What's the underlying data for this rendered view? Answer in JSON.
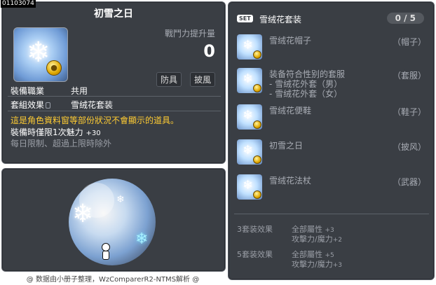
{
  "id_tag": "01103074",
  "item": {
    "name": "初雪之日",
    "power_label": "戰鬥力提升量",
    "power_value": "0",
    "tags": [
      "防具",
      "披風"
    ],
    "job_label": "裝備職業",
    "job_value": "共用",
    "set_label": "套組效果",
    "set_value": "雪绒花套装",
    "warning": "這是角色資料窗等部份狀況不會顯示的道具。",
    "charm_text": "裝備時僅限1次魅力",
    "charm_value": "+30",
    "daily_limit": "每日限制、超過上限時除外"
  },
  "footer": "@ 数据由小册子整理，WzComparerR2-NTMS解析 @",
  "set": {
    "badge": "SET",
    "name": "雪绒花套装",
    "count": "0 / 5",
    "items": [
      {
        "label": "雪绒花帽子",
        "type": "（帽子）"
      },
      {
        "label": "装备符合性别的套服",
        "type": "（套服）",
        "subs": [
          "- 雪绒花外套（男）",
          "- 雪绒花外套（女）"
        ]
      },
      {
        "label": "雪绒花便鞋",
        "type": "（鞋子）"
      },
      {
        "label": "初雪之日",
        "type": "（披风）"
      },
      {
        "label": "雪绒花法杖",
        "type": "（武器）"
      }
    ],
    "bonuses": [
      {
        "label": "3套装效果",
        "lines": [
          {
            "text": "全部屬性",
            "value": "+3"
          },
          {
            "text": "攻擊力/魔力",
            "value": "+2"
          }
        ]
      },
      {
        "label": "5套装效果",
        "lines": [
          {
            "text": "全部屬性",
            "value": "+5"
          },
          {
            "text": "攻擊力/魔力",
            "value": "+3"
          }
        ]
      }
    ]
  },
  "colors": {
    "panel": "#3a3e44",
    "warning": "#ffcc33",
    "text": "#dcdcdc"
  },
  "icons": [
    "snowflake-icon",
    "coin-icon",
    "lock-icon"
  ]
}
